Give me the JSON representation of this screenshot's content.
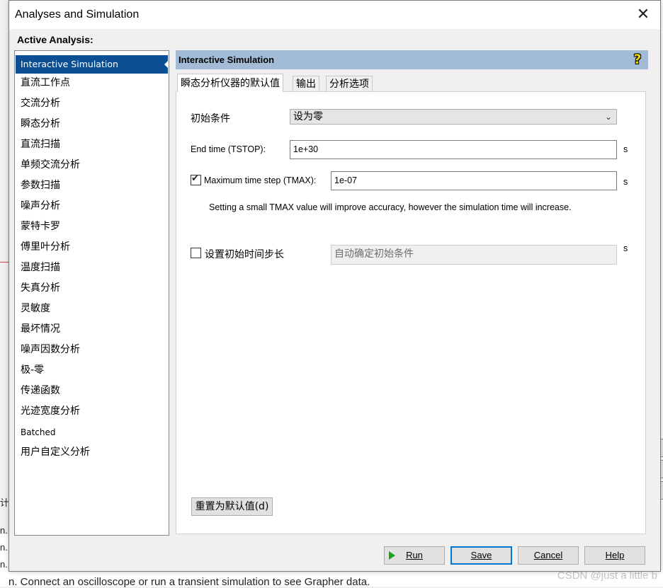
{
  "window": {
    "title": "Analyses and Simulation",
    "close_glyph": "✕",
    "active_analysis_label": "Active Analysis:"
  },
  "analysis_list": [
    {
      "label": "Interactive Simulation",
      "selected": true
    },
    {
      "label": "直流工作点"
    },
    {
      "label": "交流分析"
    },
    {
      "label": "瞬态分析"
    },
    {
      "label": "直流扫描"
    },
    {
      "label": "单频交流分析"
    },
    {
      "label": "参数扫描"
    },
    {
      "label": "噪声分析"
    },
    {
      "label": "蒙特卡罗"
    },
    {
      "label": "傅里叶分析"
    },
    {
      "label": "温度扫描"
    },
    {
      "label": "失真分析"
    },
    {
      "label": "灵敏度"
    },
    {
      "label": "最坏情况"
    },
    {
      "label": "噪声因数分析"
    },
    {
      "label": "极-零"
    },
    {
      "label": "传递函数"
    },
    {
      "label": "光迹宽度分析"
    },
    {
      "label": "Batched"
    },
    {
      "label": "用户自定义分析"
    }
  ],
  "panel": {
    "header": "Interactive Simulation",
    "help_glyph": "?",
    "tabs": [
      "瞬态分析仪器的默认值",
      "输出",
      "分析选项"
    ],
    "active_tab": 0,
    "initial_condition": {
      "label": "初始条件",
      "value": "设为零"
    },
    "end_time": {
      "label": "End time (TSTOP):",
      "value": "1e+30",
      "unit": "s"
    },
    "max_step": {
      "label": "Maximum time step (TMAX):",
      "value": "1e-07",
      "unit": "s",
      "checked": true
    },
    "hint": "Setting a small TMAX value will improve accuracy, however the simulation time will increase.",
    "initial_step": {
      "label": "设置初始时间步长",
      "value": "自动确定初始条件",
      "unit": "s",
      "checked": false
    },
    "reset_button": "重置为默认值(d)"
  },
  "buttons": {
    "run": "Run",
    "save": "Save",
    "cancel": "Cancel",
    "help": "Help"
  },
  "background": {
    "status_text": "n. Connect an oscilloscope or run a transient simulation to see Grapher data.",
    "watermark": "CSDN @just a little b",
    "side_chars": [
      "计",
      "n.",
      "n.",
      "n."
    ]
  },
  "colors": {
    "selection": "#0c4f93",
    "panel_header": "#a2bcd7",
    "default_button_border": "#0078d7",
    "run_icon": "#1aa31a"
  }
}
